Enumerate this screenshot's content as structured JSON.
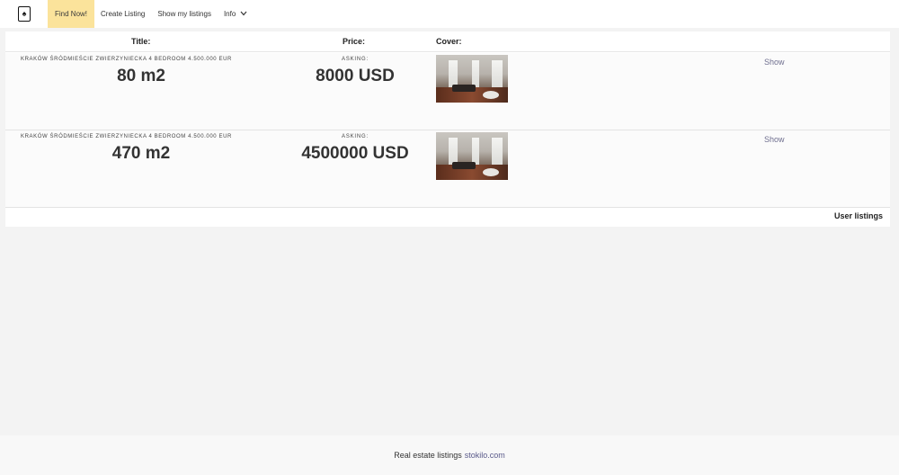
{
  "navbar": {
    "logo_glyph": "♠",
    "items": [
      {
        "label": "Find Now!",
        "active": true
      },
      {
        "label": "Create Listing"
      },
      {
        "label": "Show my listings"
      },
      {
        "label": "Info",
        "chevron": "⌄"
      }
    ]
  },
  "table": {
    "headers": {
      "title": "Title:",
      "price": "Price:",
      "cover": "Cover:"
    },
    "rows": [
      {
        "title": "KRAKÓW ŚRÓDMIEŚCIE ZWIERZYNIECKA 4 BEDROOM 4.500.000 EUR",
        "area": "80 m2",
        "asking_label": "ASKING:",
        "price": "8000 USD",
        "show_label": "Show"
      },
      {
        "title": "KRAKÓW ŚRÓDMIEŚCIE ZWIERZYNIECKA 4 BEDROOM 4.500.000 EUR",
        "area": "470 m2",
        "asking_label": "ASKING:",
        "price": "4500000 USD",
        "show_label": "Show"
      }
    ],
    "user_listings_label": "User listings"
  },
  "footer": {
    "text": "Real estate listings",
    "link": "stokilo.com"
  },
  "colors": {
    "active_nav": "#fbe39b",
    "link": "#6f6f8f",
    "background": "#f3f3f3"
  }
}
